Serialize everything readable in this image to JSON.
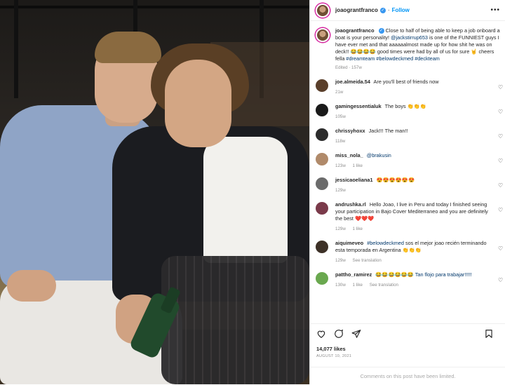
{
  "post": {
    "username": "joaograntfranco",
    "follow_label": "Follow",
    "more_label": "•••",
    "caption": {
      "username": "joaograntfranco",
      "text_1": "Close to half of being able to keep a job onboard a boat is your personality!",
      "mention": "@jackstirrup653",
      "text_2": "is one of the FUNNIEST guys I have ever met and that aaaaaalmost made up for how shit he was on deck!!",
      "emoji_1": "😂😂😂😂",
      "text_3": "good times were had by all of us for sure",
      "emoji_2": "🤘",
      "text_4": "cheers fella",
      "hashtag_1": "#dreamteam",
      "hashtag_2": "#belowdeckmed",
      "hashtag_3": "#deckteam",
      "meta": "Edited · 157w"
    },
    "likes": "14,077 likes",
    "date": "AUGUST 10, 2021",
    "comments_limited": "Comments on this post have been limited."
  },
  "comments": [
    {
      "username": "joe.almeida.54",
      "text": "Are you'll best of friends now",
      "time": "21w",
      "likes": "",
      "reply": "",
      "avatar_color": "#5a3f2b"
    },
    {
      "username": "gamingessentialuk",
      "text": "The boys 👏👏👏",
      "time": "105w",
      "likes": "",
      "reply": "",
      "avatar_color": "#1a1a1a"
    },
    {
      "username": "chrissyhoxx",
      "text": "Jack!!! The man!!",
      "time": "118w",
      "likes": "",
      "reply": "",
      "avatar_color": "#2c2c2c"
    },
    {
      "username": "miss_nola_",
      "text": "@brakusin",
      "mention": true,
      "time": "123w",
      "likes": "1 like",
      "reply": "",
      "avatar_color": "#b08a6a"
    },
    {
      "username": "jessicaoeliana1",
      "text": "😍😍😍😍😍😍",
      "time": "129w",
      "likes": "",
      "reply": "",
      "avatar_color": "#6b6b6b"
    },
    {
      "username": "andrushka.rl",
      "text": "Hello Joao, I live in Peru and today I finished seeing your participation in Bajo Cover Mediterraneo and you are definitely the best ❤️❤️❤️",
      "time": "129w",
      "likes": "1 like",
      "reply": "",
      "avatar_color": "#7a3a4a"
    },
    {
      "username": "aiquimeveo",
      "text_before": "",
      "hashtag": "#belowdeckmed",
      "text_after": "sos el mejor joao recién terminando esta temporada en Argentina 👏👏👏",
      "time": "129w",
      "likes": "",
      "reply": "See translation",
      "avatar_color": "#3d3127"
    },
    {
      "username": "pattho_ramirez",
      "text": "😂😂😂😂😂😂",
      "mention_after": "Tan flojo para trabajar!!!!!",
      "time": "130w",
      "likes": "1 like",
      "reply": "See translation",
      "avatar_color": "#6aa84f"
    }
  ],
  "colors": {
    "accent": "#0095f6",
    "verified": "#3897f0",
    "link": "#00376b",
    "muted": "#8e8e8e"
  },
  "icons": [
    "more-icon",
    "verified-icon",
    "heart-icon",
    "comment-icon",
    "share-icon",
    "bookmark-icon"
  ]
}
